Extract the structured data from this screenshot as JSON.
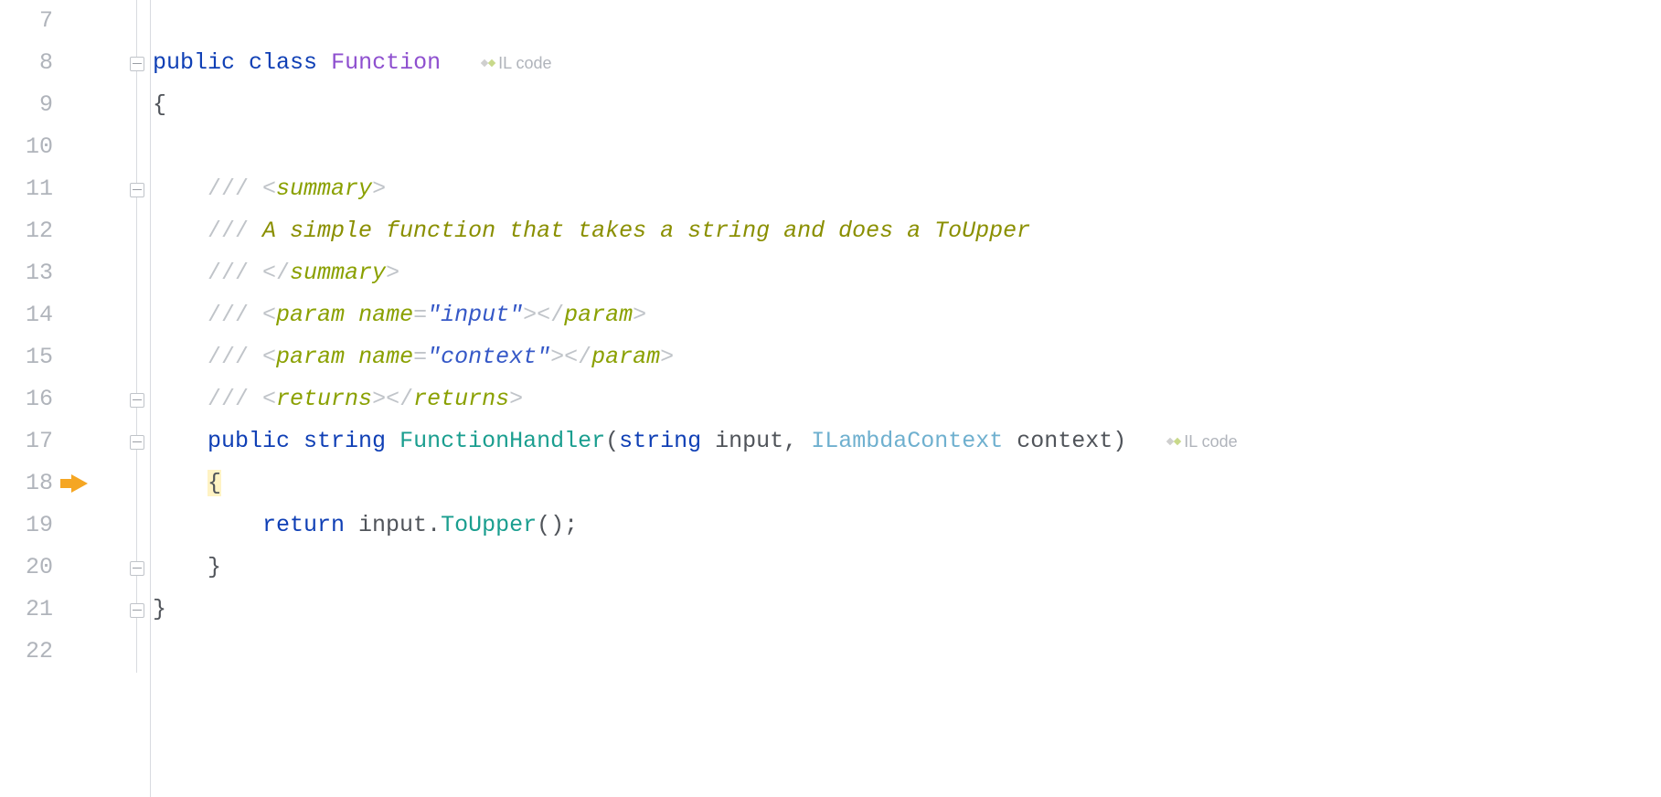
{
  "lines": {
    "l7": "7",
    "l8": "8",
    "l9": "9",
    "l10": "10",
    "l11": "11",
    "l12": "12",
    "l13": "13",
    "l14": "14",
    "l15": "15",
    "l16": "16",
    "l17": "17",
    "l18": "18",
    "l19": "19",
    "l20": "20",
    "l21": "21",
    "l22": "22"
  },
  "hint": {
    "il": "IL code"
  },
  "code": {
    "l8": {
      "public": "public",
      "class": "class",
      "Function": "Function"
    },
    "l9": {
      "brace": "{"
    },
    "l11": {
      "slashes": "/// ",
      "open": "<",
      "tag": "summary",
      "close": ">"
    },
    "l12": {
      "slashes": "/// ",
      "text": "A simple function that takes a string and does a ToUpper"
    },
    "l13": {
      "slashes": "/// ",
      "open": "</",
      "tag": "summary",
      "close": ">"
    },
    "l14": {
      "slashes": "/// ",
      "open": "<",
      "tag": "param",
      "attr": " name",
      "eq": "=",
      "val": "\"input\"",
      "closeOpen": ">",
      "open2": "</",
      "tag2": "param",
      "close2": ">"
    },
    "l15": {
      "slashes": "/// ",
      "open": "<",
      "tag": "param",
      "attr": " name",
      "eq": "=",
      "val": "\"context\"",
      "closeOpen": ">",
      "open2": "</",
      "tag2": "param",
      "close2": ">"
    },
    "l16": {
      "slashes": "/// ",
      "open": "<",
      "tag": "returns",
      "close": ">",
      "open2": "</",
      "tag2": "returns",
      "close2": ">"
    },
    "l17": {
      "public": "public",
      "string": "string",
      "method": "FunctionHandler",
      "lp": "(",
      "string2": "string",
      "p1": " input",
      "comma": ", ",
      "type": "ILambdaContext",
      "p2": " context",
      "rp": ")"
    },
    "l18": {
      "brace": "{"
    },
    "l19": {
      "return": "return",
      "input": " input",
      "dot": ".",
      "method": "ToUpper",
      "call": "();"
    },
    "l20": {
      "brace": "}"
    },
    "l21": {
      "brace": "}"
    }
  }
}
